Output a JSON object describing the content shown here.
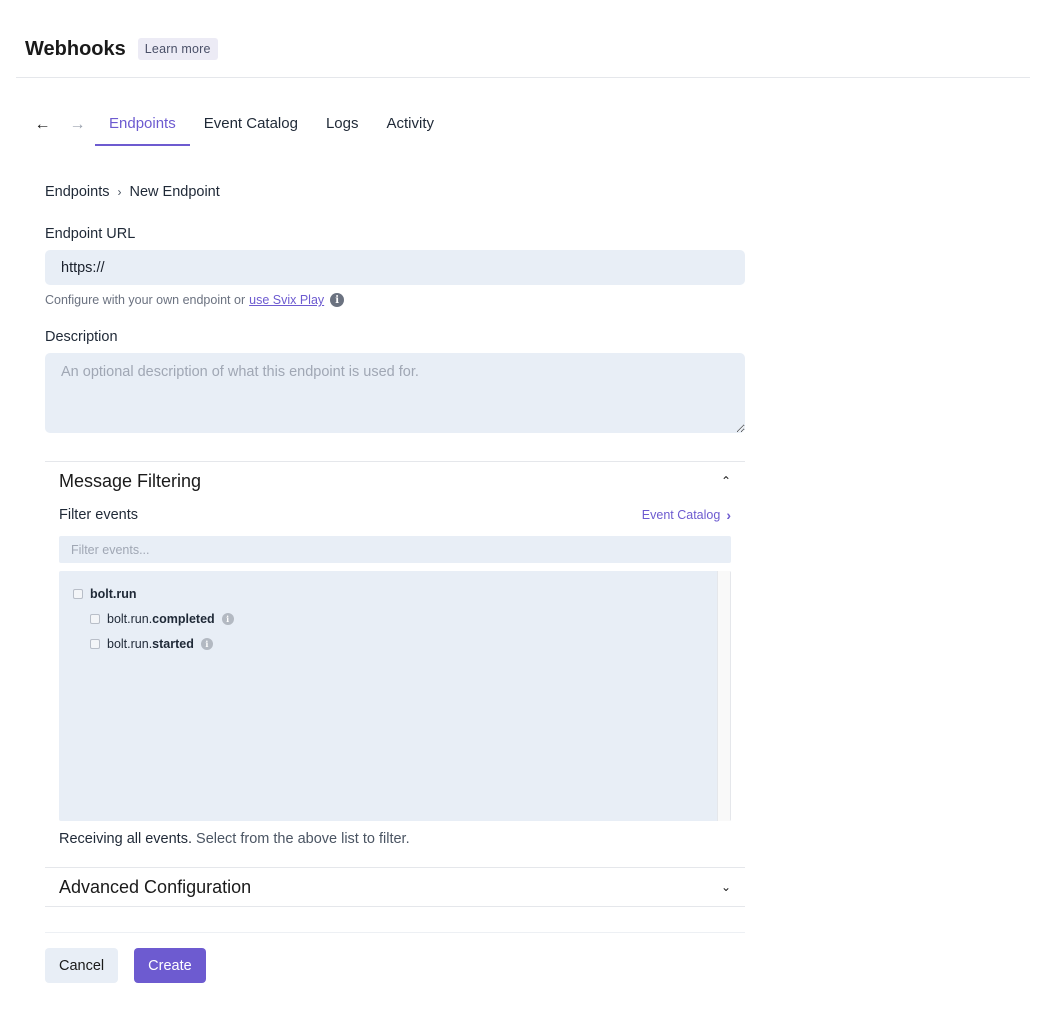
{
  "header": {
    "title": "Webhooks",
    "learn_more": "Learn more"
  },
  "nav": {
    "back_icon": "arrow-left-icon",
    "forward_icon": "arrow-right-icon",
    "back_glyph": "←",
    "forward_glyph": "→",
    "tabs": [
      {
        "label": "Endpoints",
        "active": true
      },
      {
        "label": "Event Catalog",
        "active": false
      },
      {
        "label": "Logs",
        "active": false
      },
      {
        "label": "Activity",
        "active": false
      }
    ]
  },
  "breadcrumb": {
    "parent": "Endpoints",
    "separator": "›",
    "current": "New Endpoint"
  },
  "form": {
    "url_label": "Endpoint URL",
    "url_value": "https://",
    "url_help": "Configure with your own endpoint or",
    "url_help_link": "use Svix Play",
    "info_glyph": "i",
    "description_label": "Description",
    "description_value": "",
    "description_placeholder": "An optional description of what this endpoint is used for."
  },
  "message_filtering": {
    "title": "Message Filtering",
    "expanded": true,
    "chevron_glyph": "⌃",
    "filter_label": "Filter events",
    "catalog_link": "Event Catalog",
    "catalog_arrow": "›",
    "filter_placeholder": "Filter events...",
    "filter_value": "",
    "events": [
      {
        "prefix": "bolt.run",
        "suffix": "",
        "checked": false,
        "level": 0,
        "info": false
      },
      {
        "prefix": "bolt.run.",
        "suffix": "completed",
        "checked": false,
        "level": 1,
        "info": true
      },
      {
        "prefix": "bolt.run.",
        "suffix": "started",
        "checked": false,
        "level": 1,
        "info": true
      }
    ],
    "status_strong": "Receiving all events.",
    "status_rest": " Select from the above list to filter."
  },
  "advanced": {
    "title": "Advanced Configuration",
    "expanded": false,
    "chevron_glyph": "⌄"
  },
  "actions": {
    "cancel": "Cancel",
    "create": "Create"
  },
  "colors": {
    "accent": "#6d5bd0",
    "input_bg": "#e8eef6",
    "learn_more_bg": "#ecebf5"
  }
}
